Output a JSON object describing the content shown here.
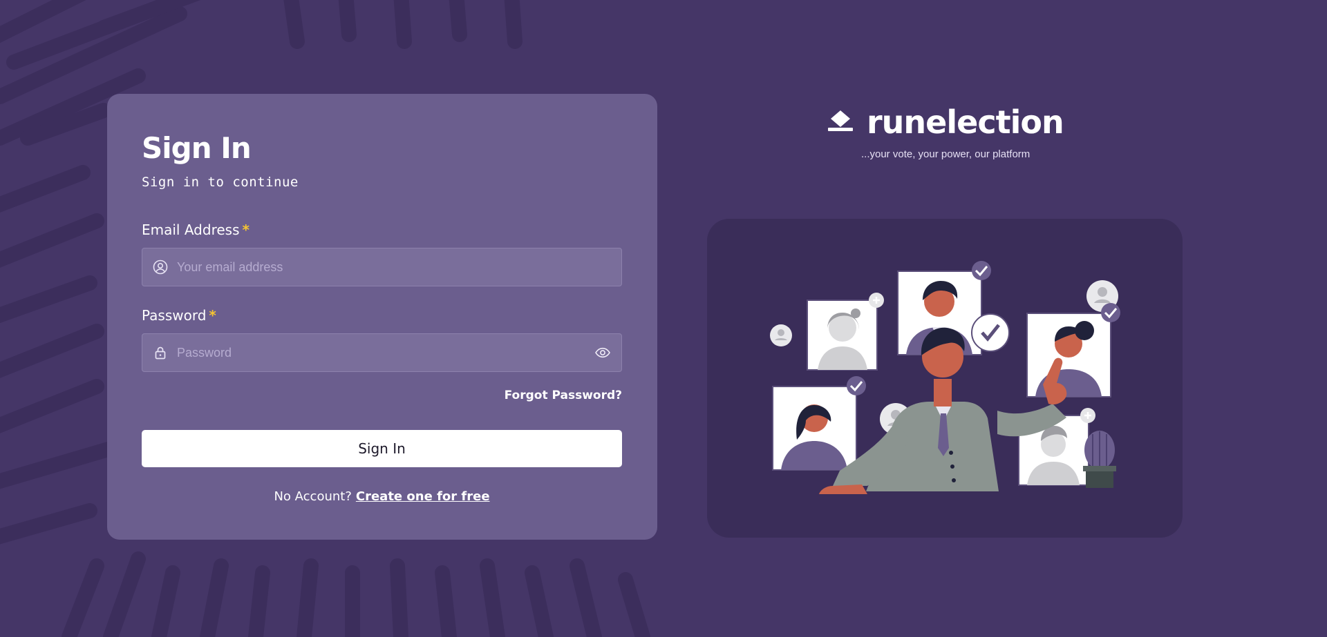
{
  "colors": {
    "background": "#453667",
    "card": "#6b5e8e",
    "input_bg": "#7a6e9b",
    "required_accent": "#f7c531",
    "illustration_bg": "#3a2d59",
    "button_bg": "#ffffff"
  },
  "signin": {
    "title": "Sign In",
    "subtitle": "Sign in to continue",
    "email": {
      "label": "Email Address",
      "required_mark": "*",
      "placeholder": "Your email address",
      "value": "",
      "icon": "user-circle-icon"
    },
    "password": {
      "label": "Password",
      "required_mark": "*",
      "placeholder": "Password",
      "value": "",
      "icon": "lock-icon",
      "toggle_icon": "eye-icon"
    },
    "forgot_password": "Forgot Password?",
    "submit_label": "Sign In",
    "no_account_text": "No Account?",
    "create_account_link": "Create one for free"
  },
  "brand": {
    "name": "runelection",
    "tagline": "...your vote, your power, our platform",
    "logo_icon": "ballot-logo-icon"
  },
  "illustration": {
    "icon": "voters-illustration"
  }
}
